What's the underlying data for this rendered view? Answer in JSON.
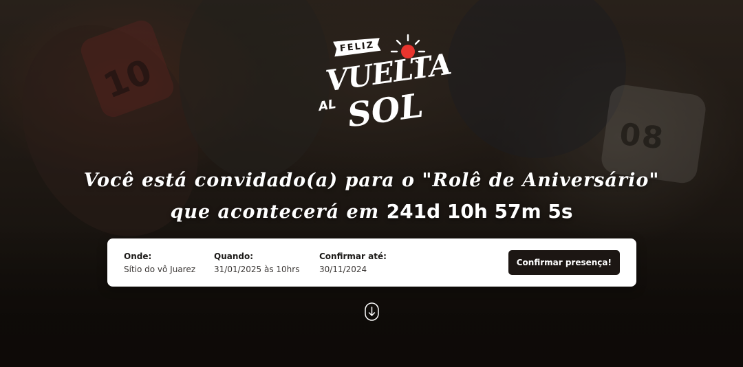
{
  "logo": {
    "tag": "FELIZ",
    "line1": "VUELTA",
    "line2a": "AL",
    "line2b": "SOL"
  },
  "headline": {
    "line1": "Você está convidado(a) para o \"Rolê de Aniversário\"",
    "line2_prefix": "que acontecerá em",
    "countdown": "241d 10h 57m 5s"
  },
  "background": {
    "plate_right": "08",
    "plate_left": "10"
  },
  "card": {
    "where_label": "Onde:",
    "where_value": "Sítio do vô Juarez",
    "when_label": "Quando:",
    "when_value": "31/01/2025 às 10hrs",
    "until_label": "Confirmar até:",
    "until_value": "30/11/2024",
    "button_label": "Confirmar presença!"
  },
  "icons": {
    "scroll": "arrow-down-circle-icon"
  }
}
